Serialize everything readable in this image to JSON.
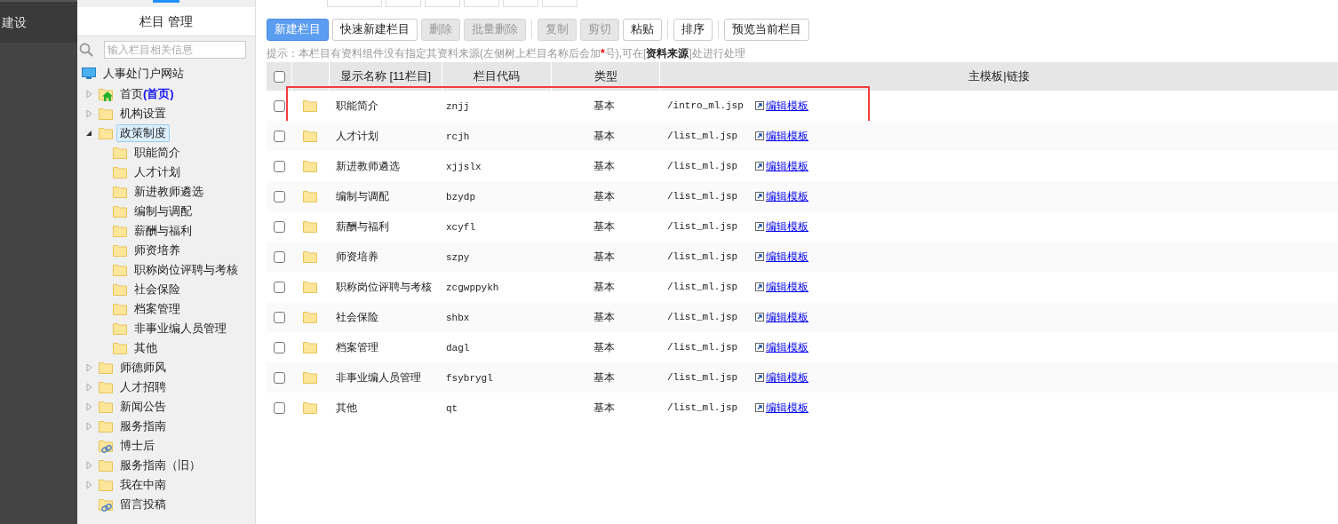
{
  "sidebar": {
    "title": "建设"
  },
  "tree_panel": {
    "title": "栏目 管理",
    "search": {
      "placeholder": "输入栏目相关信息"
    },
    "root": {
      "label": "人事处门户网站"
    },
    "items": [
      {
        "label": "首页",
        "suffix": "(首页)",
        "kind": "home",
        "expanded": false,
        "selected": false
      },
      {
        "label": "机构设置",
        "kind": "folder",
        "expanded": false,
        "selected": false
      },
      {
        "label": "政策制度",
        "kind": "folder",
        "expanded": true,
        "selected": true,
        "children": [
          {
            "label": "职能简介"
          },
          {
            "label": "人才计划"
          },
          {
            "label": "新进教师遴选"
          },
          {
            "label": "编制与调配"
          },
          {
            "label": "薪酬与福利"
          },
          {
            "label": "师资培养"
          },
          {
            "label": "职称岗位评聘与考核"
          },
          {
            "label": "社会保险"
          },
          {
            "label": "档案管理"
          },
          {
            "label": "非事业编人员管理"
          },
          {
            "label": "其他"
          }
        ]
      },
      {
        "label": "师德师风",
        "kind": "folder",
        "expanded": false,
        "selected": false
      },
      {
        "label": "人才招聘",
        "kind": "folder",
        "expanded": false,
        "selected": false
      },
      {
        "label": "新闻公告",
        "kind": "folder",
        "expanded": false,
        "selected": false
      },
      {
        "label": "服务指南",
        "kind": "folder",
        "expanded": false,
        "selected": false
      },
      {
        "label": "博士后",
        "kind": "link",
        "selected": false
      },
      {
        "label": "服务指南（旧）",
        "kind": "folder",
        "expanded": false,
        "selected": false
      },
      {
        "label": "我在中南",
        "kind": "folder",
        "expanded": false,
        "selected": false
      },
      {
        "label": "留言投稿",
        "kind": "link",
        "selected": false
      }
    ]
  },
  "toolbar": [
    {
      "label": "新建栏目",
      "kind": "primary",
      "disabled": false
    },
    {
      "label": "快速新建栏目",
      "kind": "normal",
      "disabled": false
    },
    {
      "label": "删除",
      "kind": "normal",
      "disabled": true
    },
    {
      "label": "批量删除",
      "kind": "normal",
      "disabled": true
    },
    {
      "kind": "separator"
    },
    {
      "label": "复制",
      "kind": "normal",
      "disabled": true
    },
    {
      "label": "剪切",
      "kind": "normal",
      "disabled": true
    },
    {
      "label": "粘贴",
      "kind": "normal",
      "disabled": false
    },
    {
      "kind": "separator"
    },
    {
      "label": "排序",
      "kind": "normal",
      "disabled": false
    },
    {
      "kind": "separator"
    },
    {
      "label": "预览当前栏目",
      "kind": "normal",
      "disabled": false
    }
  ],
  "hint": [
    {
      "kind": "text",
      "text": "提示：本栏目有资料组件没有指定其资料来源(左侧树上栏目名称后会加"
    },
    {
      "kind": "mark",
      "text": "*"
    },
    {
      "kind": "text",
      "text": "号),可在["
    },
    {
      "kind": "strong",
      "text": "资料来源"
    },
    {
      "kind": "text",
      "text": "]处进行处理"
    }
  ],
  "table": {
    "select_all": {
      "checked": false
    },
    "columns": [
      "显示名称 [11栏目]",
      "栏目代码",
      "类型",
      "主模板|链接"
    ],
    "rows": [
      {
        "name": "职能简介",
        "code": "znjj",
        "type": "基本",
        "template": "/intro_ml.jsp",
        "link": "编辑模板",
        "checked": false,
        "highlighted": true
      },
      {
        "name": "人才计划",
        "code": "rcjh",
        "type": "基本",
        "template": "/list_ml.jsp",
        "link": "编辑模板",
        "checked": false,
        "highlighted": false
      },
      {
        "name": "新进教师遴选",
        "code": "xjjslx",
        "type": "基本",
        "template": "/list_ml.jsp",
        "link": "编辑模板",
        "checked": false,
        "highlighted": false
      },
      {
        "name": "编制与调配",
        "code": "bzydp",
        "type": "基本",
        "template": "/list_ml.jsp",
        "link": "编辑模板",
        "checked": false,
        "highlighted": false
      },
      {
        "name": "薪酬与福利",
        "code": "xcyfl",
        "type": "基本",
        "template": "/list_ml.jsp",
        "link": "编辑模板",
        "checked": false,
        "highlighted": false
      },
      {
        "name": "师资培养",
        "code": "szpy",
        "type": "基本",
        "template": "/list_ml.jsp",
        "link": "编辑模板",
        "checked": false,
        "highlighted": false
      },
      {
        "name": "职称岗位评聘与考核",
        "code": "zcgwppykh",
        "type": "基本",
        "template": "/list_ml.jsp",
        "link": "编辑模板",
        "checked": false,
        "highlighted": false
      },
      {
        "name": "社会保险",
        "code": "shbx",
        "type": "基本",
        "template": "/list_ml.jsp",
        "link": "编辑模板",
        "checked": false,
        "highlighted": false
      },
      {
        "name": "档案管理",
        "code": "dagl",
        "type": "基本",
        "template": "/list_ml.jsp",
        "link": "编辑模板",
        "checked": false,
        "highlighted": false
      },
      {
        "name": "非事业编人员管理",
        "code": "fsybrygl",
        "type": "基本",
        "template": "/list_ml.jsp",
        "link": "编辑模板",
        "checked": false,
        "highlighted": false
      },
      {
        "name": "其他",
        "code": "qt",
        "type": "基本",
        "template": "/list_ml.jsp",
        "link": "编辑模板",
        "checked": false,
        "highlighted": false
      }
    ]
  }
}
